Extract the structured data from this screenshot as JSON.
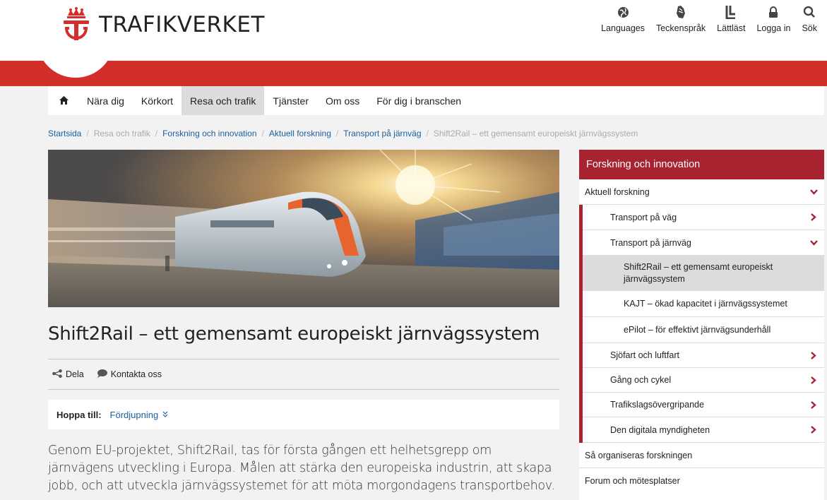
{
  "header": {
    "brand": "TRAFIKVERKET",
    "utility": [
      {
        "label": "Languages",
        "icon": "globe-icon"
      },
      {
        "label": "Teckenspråk",
        "icon": "sign-language-icon"
      },
      {
        "label": "Lättläst",
        "icon": "easy-read-icon"
      },
      {
        "label": "Logga in",
        "icon": "lock-icon"
      },
      {
        "label": "Sök",
        "icon": "search-icon"
      }
    ]
  },
  "nav": {
    "items": [
      "Nära dig",
      "Körkort",
      "Resa och trafik",
      "Tjänster",
      "Om oss",
      "För dig i branschen"
    ],
    "active_index": 2
  },
  "breadcrumb": {
    "items": [
      "Startsida",
      "Resa och trafik",
      "Forskning och innovation",
      "Aktuell forskning",
      "Transport på järnväg",
      "Shift2Rail – ett gemensamt europeiskt järnvägssystem"
    ]
  },
  "article": {
    "title": "Shift2Rail – ett gemensamt europeiskt järnvägssystem",
    "share_label": "Dela",
    "contact_label": "Kontakta oss",
    "jump_label": "Hoppa till:",
    "jump_link": "Fördjupning",
    "intro": "Genom EU-projektet, Shift2Rail, tas för första gången ett helhetsgrepp om järnvägens utveckling i Europa. Målen att stärka den europeiska industrin, att skapa jobb, och att utveckla järnvägssystemet för att möta morgondagens transportbehov."
  },
  "sidebar": {
    "heading": "Forskning och innovation",
    "items": [
      {
        "label": "Aktuell forskning",
        "level": 1,
        "chevron": "down"
      },
      {
        "label": "Transport på väg",
        "level": 2,
        "chevron": "right"
      },
      {
        "label": "Transport på järnväg",
        "level": 2,
        "chevron": "down"
      },
      {
        "label": "Shift2Rail – ett gemensamt europeiskt järnvägssystem",
        "level": 3,
        "active": true
      },
      {
        "label": "KAJT – ökad kapacitet i järnvägssystemet",
        "level": 3
      },
      {
        "label": "ePilot – för effektivt järnvägsunderhåll",
        "level": 3
      },
      {
        "label": "Sjöfart och luftfart",
        "level": 2,
        "chevron": "right"
      },
      {
        "label": "Gång och cykel",
        "level": 2,
        "chevron": "right"
      },
      {
        "label": "Trafikslagsövergripande",
        "level": 2,
        "chevron": "right"
      },
      {
        "label": "Den digitala myndigheten",
        "level": 2,
        "chevron": "right"
      },
      {
        "label": "Så organiseras forskningen",
        "level": 1
      },
      {
        "label": "Forum och mötesplatser",
        "level": 1
      }
    ]
  },
  "colors": {
    "brand_red": "#d22f2a",
    "sidebar_red": "#a6232f",
    "link_blue": "#1b5f9e"
  }
}
